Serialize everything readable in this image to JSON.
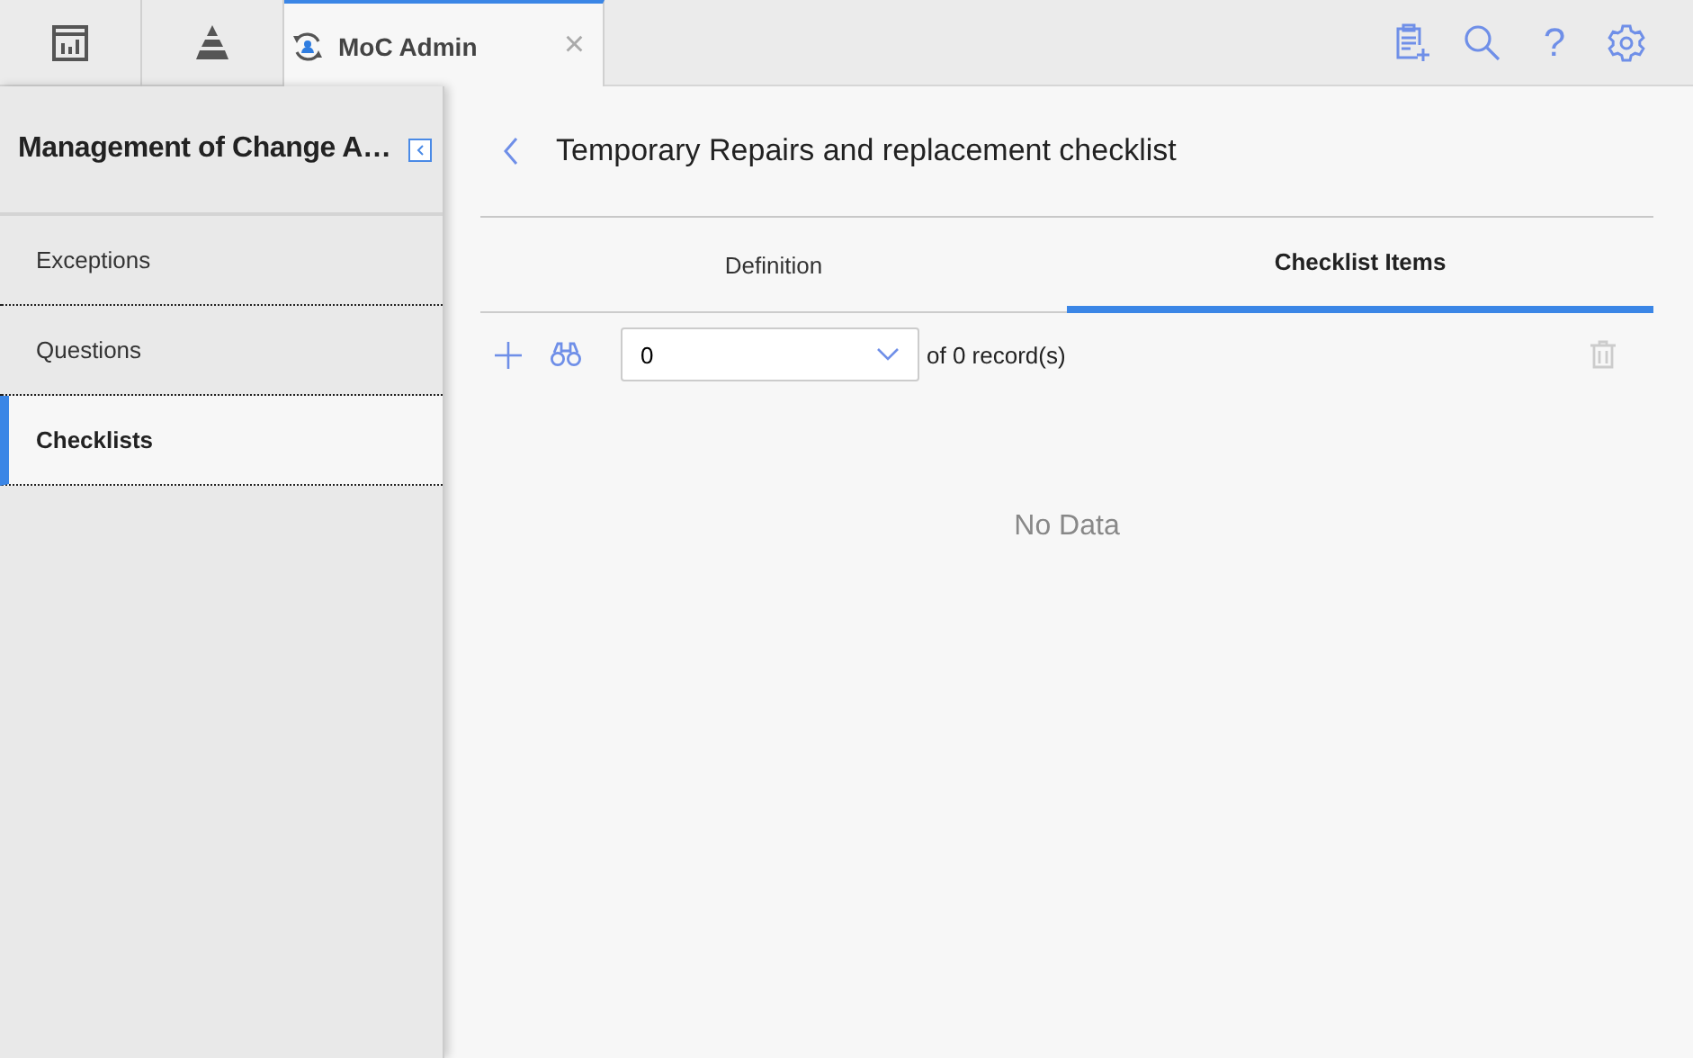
{
  "top_bar": {
    "tabs": [
      {
        "kind": "icon",
        "selected": false
      },
      {
        "kind": "icon",
        "selected": false
      },
      {
        "kind": "titled",
        "label": "MoC Admin",
        "close": "×",
        "selected": true
      }
    ],
    "help_glyph": "?"
  },
  "sidebar": {
    "title": "Management of Change A…",
    "items": [
      {
        "label": "Exceptions",
        "selected": false
      },
      {
        "label": "Questions",
        "selected": false
      },
      {
        "label": "Checklists",
        "selected": true
      }
    ]
  },
  "main": {
    "title": "Temporary Repairs and replacement checklist",
    "tabs": [
      {
        "label": "Definition",
        "selected": false
      },
      {
        "label": "Checklist Items",
        "selected": true
      }
    ],
    "pager": {
      "value": "0",
      "summary": "of 0 record(s)"
    },
    "empty_text": "No Data"
  }
}
